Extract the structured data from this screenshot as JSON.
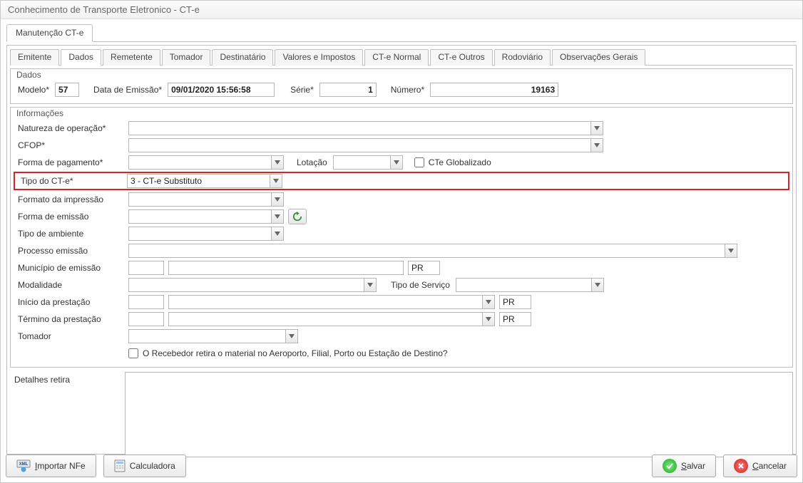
{
  "window": {
    "title": "Conhecimento de Transporte Eletronico - CT-e"
  },
  "outer_tabs": {
    "t0": "Manutenção CT-e"
  },
  "inner_tabs": {
    "t0": "Emitente",
    "t1": "Dados",
    "t2": "Remetente",
    "t3": "Tomador",
    "t4": "Destinatário",
    "t5": "Valores e Impostos",
    "t6": "CT-e Normal",
    "t7": "CT-e Outros",
    "t8": "Rodoviário",
    "t9": "Observações Gerais"
  },
  "group_dados": {
    "legend": "Dados",
    "modelo_label": "Modelo*",
    "modelo": "57",
    "data_emissao_label": "Data de Emissão*",
    "data_emissao": "09/01/2020 15:56:58",
    "serie_label": "Série*",
    "serie": "1",
    "numero_label": "Número*",
    "numero": "19163"
  },
  "group_info": {
    "legend": "Informações",
    "natureza_label": "Natureza de operação*",
    "natureza": "",
    "cfop_label": "CFOP*",
    "cfop": "",
    "forma_pag_label": "Forma de pagamento*",
    "forma_pag": "",
    "lotacao_label": "Lotação",
    "lotacao": "",
    "cte_global_label": "CTe Globalizado",
    "tipo_cte_label": "Tipo do CT-e*",
    "tipo_cte": "3 - CT-e Substituto",
    "formato_imp_label": "Formato da impressão",
    "formato_imp": "",
    "forma_emi_label": "Forma de emissão",
    "forma_emi": "",
    "tipo_amb_label": "Tipo de ambiente",
    "tipo_amb": "",
    "proc_emi_label": "Processo emissão",
    "proc_emi": "",
    "munic_emi_label": "Município de emissão",
    "munic_emi_code": "",
    "munic_emi_desc": "",
    "munic_emi_uf": "PR",
    "modalidade_label": "Modalidade",
    "modalidade": "",
    "tipo_servico_label": "Tipo de Serviço",
    "tipo_servico": "",
    "inicio_prest_label": "Início da prestação",
    "inicio_prest_code": "",
    "inicio_prest_desc": "",
    "inicio_prest_uf": "PR",
    "termino_prest_label": "Término da prestação",
    "termino_prest_code": "",
    "termino_prest_desc": "",
    "termino_prest_uf": "PR",
    "tomador_label": "Tomador",
    "tomador": "",
    "recebedor_chk_label": "O Recebedor retira o material no Aeroporto, Filial, Porto ou Estação de Destino?"
  },
  "detalhes": {
    "label": "Detalhes retira",
    "value": ""
  },
  "buttons": {
    "importar": "Importar NFe",
    "calculadora": "Calculadora",
    "salvar": "Salvar",
    "cancelar": "Cancelar"
  }
}
